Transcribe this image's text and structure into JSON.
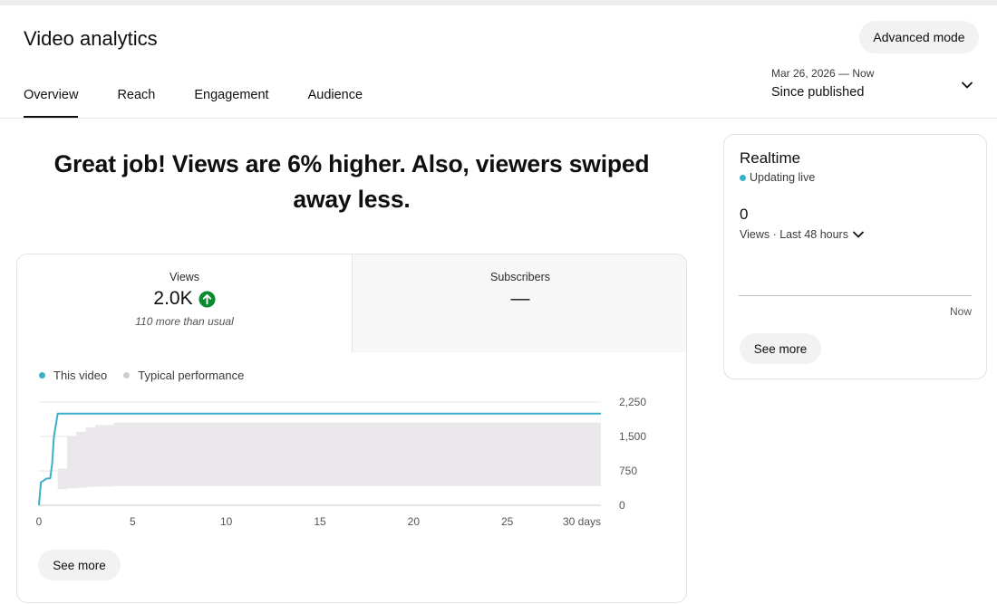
{
  "header": {
    "title": "Video analytics",
    "advanced_mode_label": "Advanced mode"
  },
  "tabs": [
    {
      "label": "Overview",
      "active": true
    },
    {
      "label": "Reach",
      "active": false
    },
    {
      "label": "Engagement",
      "active": false
    },
    {
      "label": "Audience",
      "active": false
    }
  ],
  "date_range": {
    "range": "Mar 26, 2026 — Now",
    "value": "Since published",
    "icon": "chevron-down-icon"
  },
  "headline": "Great job! Views are 6% higher. Also, viewers swiped away less.",
  "metrics": {
    "views": {
      "label": "Views",
      "value": "2.0K",
      "note": "110 more than usual",
      "trend_icon": "arrow-up-circle-icon",
      "trend_color": "#0b8a2f"
    },
    "subscribers": {
      "label": "Subscribers",
      "value": "—"
    }
  },
  "legend": {
    "this_video": "This video",
    "typical": "Typical performance"
  },
  "colors": {
    "this_video": "#3ab0c8",
    "typical_band": "#ebe8ec",
    "typical_dot": "#cfcfcf",
    "axis_text": "#555555"
  },
  "chart_data": {
    "type": "line",
    "x_unit_label": "days",
    "xticks": [
      "0",
      "5",
      "10",
      "15",
      "20",
      "25",
      "30 days"
    ],
    "xtick_values": [
      0,
      5,
      10,
      15,
      20,
      25,
      30
    ],
    "yticks": [
      "0",
      "750",
      "1,500",
      "2,250"
    ],
    "ytick_values": [
      0,
      750,
      1500,
      2250
    ],
    "xlim": [
      0,
      30
    ],
    "ylim": [
      0,
      2250
    ],
    "grid": true,
    "y_axis_side": "right",
    "series": [
      {
        "name": "This video",
        "x": [
          0,
          0.1,
          0.4,
          0.6,
          0.7,
          0.8,
          1.0,
          30
        ],
        "y": [
          0,
          500,
          580,
          590,
          900,
          1500,
          2000,
          2000
        ]
      }
    ],
    "typical_band": {
      "name": "Typical performance",
      "x": [
        0,
        0.5,
        1.0,
        1.5,
        2.0,
        2.5,
        3.0,
        4.0,
        30
      ],
      "low": [
        0,
        300,
        350,
        370,
        380,
        400,
        410,
        420,
        420
      ],
      "high": [
        0,
        300,
        800,
        1500,
        1600,
        1700,
        1750,
        1800,
        1800
      ]
    }
  },
  "see_more_label": "See more",
  "realtime": {
    "title": "Realtime",
    "status": "Updating live",
    "count": "0",
    "period": "Views · Last 48 hours",
    "axis_end": "Now",
    "see_more_label": "See more"
  }
}
